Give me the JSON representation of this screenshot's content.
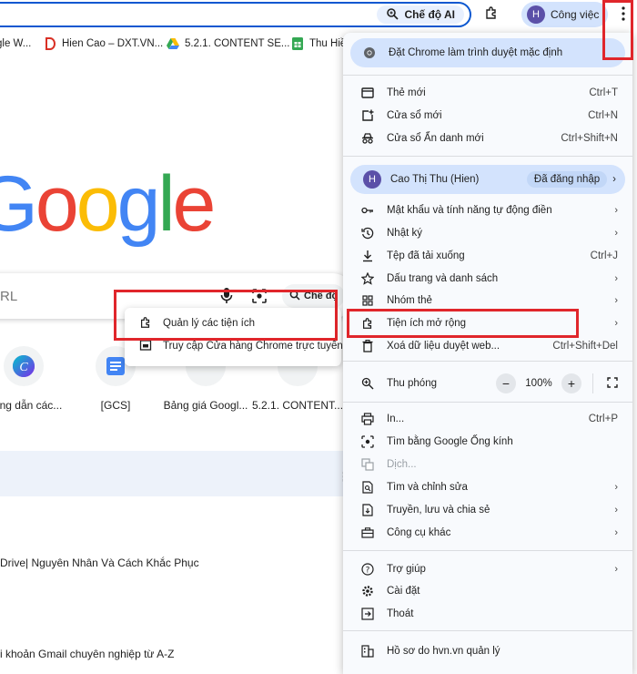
{
  "toolbar": {
    "ai_mode_label": "Chế độ AI",
    "profile_initial": "H",
    "profile_label": "Công việc"
  },
  "bookmarks": [
    {
      "label": "gle W..."
    },
    {
      "label": "Hien Cao – DXT.VN..."
    },
    {
      "label": "5.2.1. CONTENT SE..."
    },
    {
      "label": "Thu Hiề"
    }
  ],
  "page": {
    "logo_letters": [
      "G",
      "o",
      "o",
      "g",
      "l",
      "e"
    ],
    "logo_colors": [
      "#4285f4",
      "#ea4335",
      "#fbbc05",
      "#4285f4",
      "#34a853",
      "#ea4335"
    ],
    "search_placeholder": "RL",
    "ai_mode_short": "Chế độ",
    "shortcuts": [
      {
        "label": "ướng dẫn các..."
      },
      {
        "label": "[GCS]"
      },
      {
        "label": "Bảng giá Googl..."
      },
      {
        "label": "5.2.1. CONTENT..."
      }
    ],
    "feed": [
      {
        "text": "Drive| Nguyên Nhân Và Cách Khắc Phục"
      },
      {
        "text": "i khoản Gmail chuyên nghiệp từ A-Z"
      }
    ]
  },
  "extension_submenu": {
    "items": [
      {
        "label": "Quản lý các tiện ích",
        "icon": "puzzle-icon"
      },
      {
        "label": "Truy cập Cửa hàng Chrome trực tuyến",
        "icon": "store-icon"
      }
    ]
  },
  "menu": {
    "default_browser": "Đặt Chrome làm trình duyệt mặc định",
    "new_tab": {
      "label": "Thẻ mới",
      "shortcut": "Ctrl+T"
    },
    "new_window": {
      "label": "Cửa sổ mới",
      "shortcut": "Ctrl+N"
    },
    "incognito": {
      "label": "Cửa sổ Ẩn danh mới",
      "shortcut": "Ctrl+Shift+N"
    },
    "profile": {
      "initial": "H",
      "name": "Cao Thị Thu (Hien)",
      "status": "Đã đăng nhập"
    },
    "passwords": {
      "label": "Mật khẩu và tính năng tự động điền"
    },
    "history": {
      "label": "Nhật ký"
    },
    "downloads": {
      "label": "Tệp đã tải xuống",
      "shortcut": "Ctrl+J"
    },
    "bookmarks": {
      "label": "Dấu trang và danh sách"
    },
    "tab_groups": {
      "label": "Nhóm thẻ"
    },
    "extensions": {
      "label": "Tiện ích mở rộng"
    },
    "clear_data": {
      "label": "Xoá dữ liệu duyệt web...",
      "shortcut": "Ctrl+Shift+Del"
    },
    "zoom": {
      "label": "Thu phóng",
      "minus": "−",
      "value": "100%",
      "plus": "+"
    },
    "print": {
      "label": "In...",
      "shortcut": "Ctrl+P"
    },
    "lens": {
      "label": "Tìm bằng Google Ống kính"
    },
    "translate": {
      "label": "Dịch..."
    },
    "find_edit": {
      "label": "Tìm và chỉnh sửa"
    },
    "cast_save": {
      "label": "Truyền, lưu và chia sẻ"
    },
    "more_tools": {
      "label": "Công cụ khác"
    },
    "help": {
      "label": "Trợ giúp"
    },
    "settings": {
      "label": "Cài đặt"
    },
    "exit": {
      "label": "Thoát"
    },
    "managed": {
      "label": "Hồ sơ do hvn.vn quản lý"
    }
  },
  "colors": {
    "accent": "#0b57d0",
    "highlight": "#d3e3fd",
    "annotation_red": "#e0262b",
    "menu_bg": "#f8fafd"
  }
}
